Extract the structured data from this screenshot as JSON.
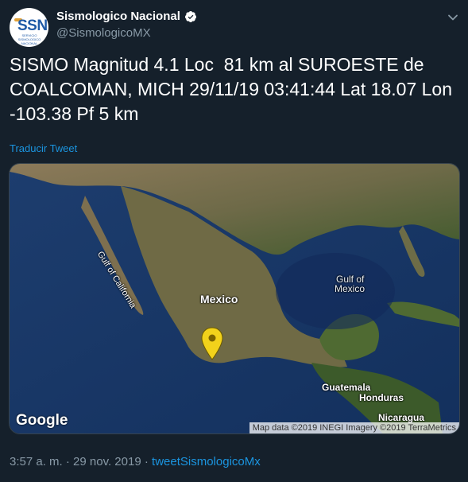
{
  "account": {
    "name": "Sismologico Nacional",
    "handle": "@SismologicoMX",
    "avatar_text": "SSN",
    "avatar_sub": "SERVICIO SISMOLOGICO NACIONAL",
    "avatar_top": "MEXICO"
  },
  "tweet": {
    "text": "SISMO Magnitud 4.1 Loc  81 km al SUROESTE de COALCOMAN, MICH 29/11/19 03:41:44 Lat 18.07 Lon -103.38 Pf 5 km",
    "translate_label": "Traducir Tweet"
  },
  "map": {
    "labels": {
      "gulf_california": "Gulf of California",
      "mexico": "Mexico",
      "gulf_mexico_1": "Gulf of",
      "gulf_mexico_2": "Mexico",
      "guatemala": "Guatemala",
      "honduras": "Honduras",
      "nicaragua": "Nicaragua"
    },
    "google_logo": "Google",
    "attribution": "Map data ©2019 INEGI  Imagery ©2019 TerraMetrics"
  },
  "footer": {
    "time": "3:57 a. m.",
    "separator": "·",
    "date": "29 nov. 2019",
    "source": "tweetSismologicoMx"
  },
  "colors": {
    "background": "#15202b",
    "link": "#1b95e0",
    "secondary_text": "#8899a6",
    "pin": "#f2d21b"
  }
}
